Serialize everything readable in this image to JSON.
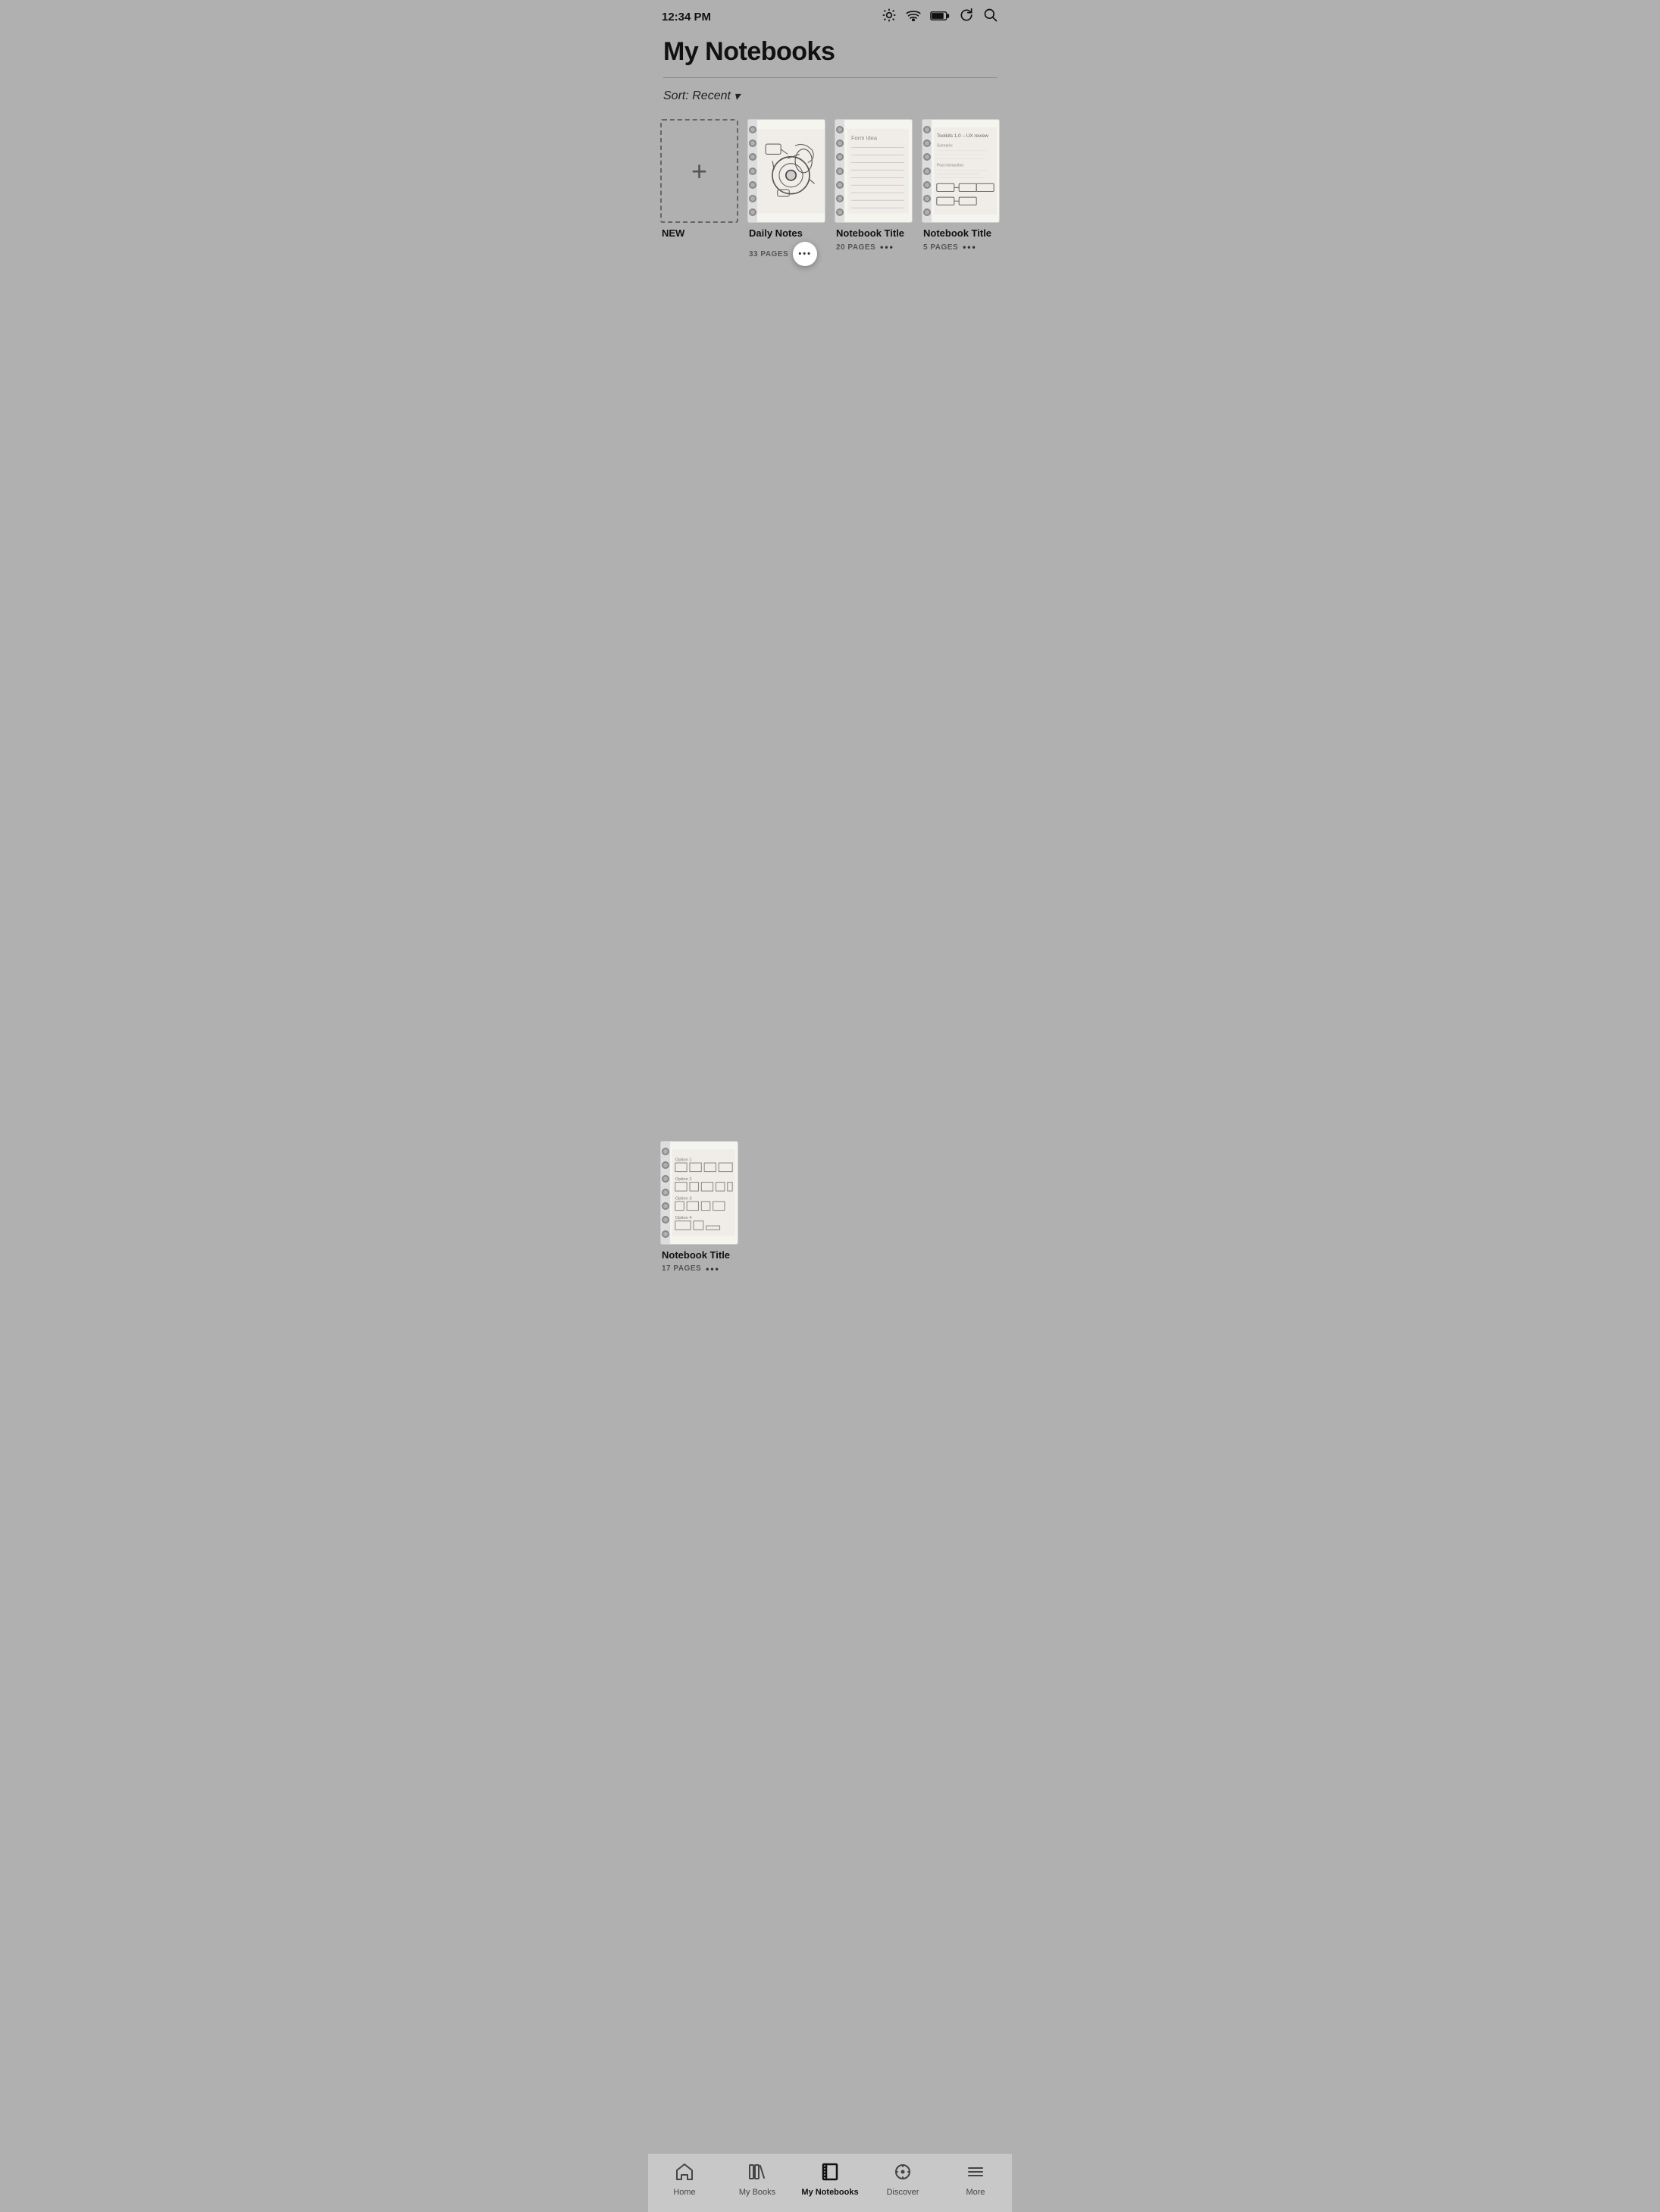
{
  "status": {
    "time": "12:34 PM"
  },
  "header": {
    "title": "My Notebooks"
  },
  "sort": {
    "label": "Sort: Recent",
    "chevron": "▾"
  },
  "notebooks": [
    {
      "id": "new",
      "type": "new",
      "label": "NEW"
    },
    {
      "id": "daily-notes",
      "type": "regular",
      "name": "Daily Notes",
      "pages": "33 PAGES",
      "active_more": true
    },
    {
      "id": "notebook-2",
      "type": "regular",
      "name": "Notebook Title",
      "pages": "20 PAGES",
      "active_more": false
    },
    {
      "id": "notebook-3",
      "type": "regular",
      "name": "Notebook Title",
      "pages": "5 PAGES",
      "active_more": false
    },
    {
      "id": "notebook-4",
      "type": "regular",
      "name": "Notebook Title",
      "pages": "17 PAGES",
      "active_more": false,
      "row2": true
    }
  ],
  "nav": {
    "items": [
      {
        "id": "home",
        "label": "Home",
        "icon": "home"
      },
      {
        "id": "my-books",
        "label": "My Books",
        "icon": "books"
      },
      {
        "id": "my-notebooks",
        "label": "My Notebooks",
        "icon": "notebooks",
        "active": true
      },
      {
        "id": "discover",
        "label": "Discover",
        "icon": "discover"
      },
      {
        "id": "more",
        "label": "More",
        "icon": "more-menu"
      }
    ]
  }
}
